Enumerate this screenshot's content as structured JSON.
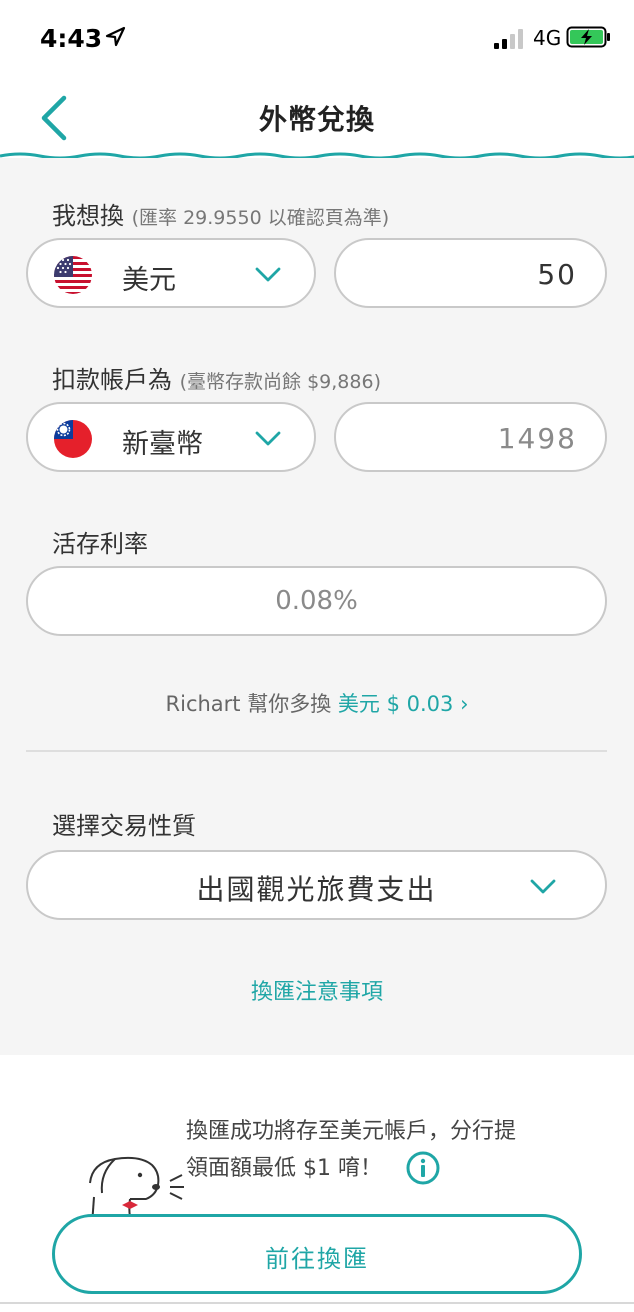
{
  "status_bar": {
    "time": "4:43",
    "network": "4G"
  },
  "nav": {
    "title": "外幣兌換"
  },
  "exchange": {
    "label": "我想換",
    "rate_note": "(匯率 29.9550 以確認頁為準)",
    "currency": "美元",
    "amount": "50"
  },
  "debit": {
    "label": "扣款帳戶為",
    "balance_note": "(臺幣存款尚餘 $9,886)",
    "currency": "新臺幣",
    "amount": "1498"
  },
  "interest": {
    "label": "活存利率",
    "value": "0.08%"
  },
  "promo": {
    "prefix": "Richart 幫你多換",
    "highlight": "美元 $ 0.03",
    "arrow": "›"
  },
  "purpose": {
    "label": "選擇交易性質",
    "value": "出國觀光旅費支出"
  },
  "notice_link": "換匯注意事項",
  "footer": {
    "line1": "換匯成功將存至美元帳戶，分行提",
    "line2": "領面額最低 $1 唷！",
    "cta": "前往換匯"
  },
  "colors": {
    "accent": "#1fa6a6",
    "background": "#f5f5f5"
  }
}
